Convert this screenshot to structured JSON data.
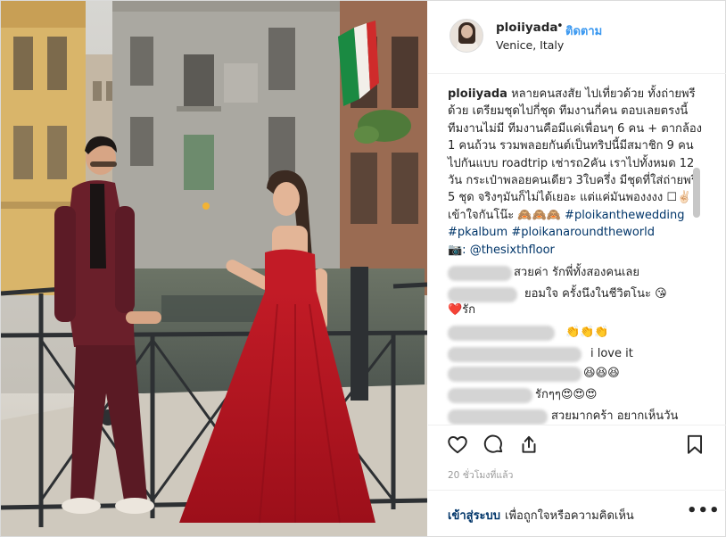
{
  "post": {
    "username": "ploiiyada",
    "separator": "•",
    "follow_label": "ติดตาม",
    "location": "Venice, Italy"
  },
  "caption": {
    "username": "ploiiyada",
    "text": "หลายคนสงสัย ไปเที่ยวด้วย ทั้งถ่ายพรีด้วย เตรียมชุดไปกี่ชุด ทีมงานกี่คน ตอบเลยตรงนี้ ทีมงานไม่มี ทีมงานคือมีแค่เพื่อนๆ 6 คน + ตากล้อง 1 คนถ้วน รวมพลอยกันต์เป็นทริปนี้มีสมาชิก 9 คน ไปกันแบบ roadtrip เช่ารถ2คัน เราไปทั้งหมด 12 วัน กระเป๋าพลอยคนเดียว 3ใบครึ่ง มีชุดที่ใส่ถ่ายพรี 5 ชุด จริงๆมันก็ไม่ได้เยอะ แต่แค่มันพองงงง ☐✌🏻 เข้าใจกันโน๊ะ 🙈🙈🙈",
    "hashtags": [
      "#ploikanthewedding",
      "#pkalbum",
      "#ploikanaroundtheworld"
    ],
    "credit": "📷: @thesixthfloor"
  },
  "comments": [
    {
      "text": "สวยค่า รักพี่ทั้งสองคนเลย"
    },
    {
      "text": "ยอมใจ ครั้งนึงในชีวิตโนะ 😘",
      "extra": "❤️รัก"
    },
    {
      "text": "👏👏👏"
    },
    {
      "text": "i love it"
    },
    {
      "text": "😆😆😆"
    },
    {
      "text": "รักๆๆ😍😍😍"
    },
    {
      "text": "สวยมากคร้า อยากเห็นวัน"
    }
  ],
  "actions": {
    "like": "heart-icon",
    "comment": "comment-bubble-icon",
    "share": "share-icon",
    "save": "bookmark-icon"
  },
  "timestamp": "20 ชั่วโมงที่แล้ว",
  "footer": {
    "login_label": "เข้าสู่ระบบ",
    "login_hint": "เพื่อถูกใจหรือความคิดเห็น",
    "more_label": "•••"
  },
  "colors": {
    "link_blue": "#3897f0",
    "hashtag_blue": "#003569",
    "dress_red": "#b3141f",
    "suit_burgundy": "#6a1f2a"
  }
}
